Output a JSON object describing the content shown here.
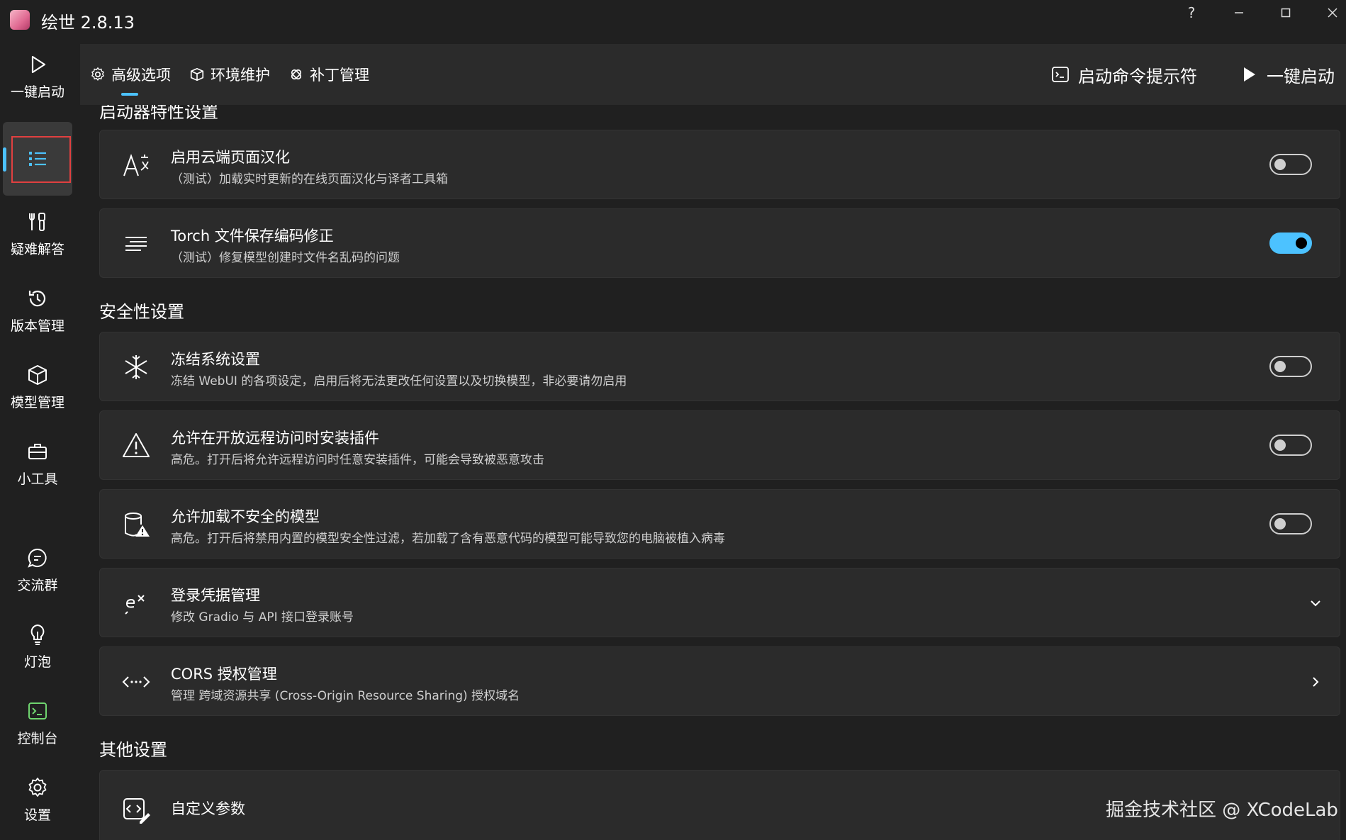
{
  "window": {
    "title": "绘世 2.8.13",
    "help": "?",
    "minimize": "–",
    "maximize": "☐",
    "close": "✕"
  },
  "sidebar": {
    "items": [
      {
        "label": "一键启动",
        "icon": "play-icon"
      },
      {
        "label": "",
        "icon": "list-icon",
        "selected": true
      },
      {
        "label": "疑难解答",
        "icon": "tools-icon"
      },
      {
        "label": "版本管理",
        "icon": "history-icon"
      },
      {
        "label": "模型管理",
        "icon": "cube-icon"
      },
      {
        "label": "小工具",
        "icon": "toolbox-icon"
      },
      {
        "label": "交流群",
        "icon": "chat-icon"
      },
      {
        "label": "灯泡",
        "icon": "bulb-icon"
      },
      {
        "label": "控制台",
        "icon": "console-icon"
      },
      {
        "label": "设置",
        "icon": "gear-icon"
      }
    ]
  },
  "topnav": {
    "tabs": [
      {
        "label": "高级选项",
        "icon": "gear-icon",
        "active": true
      },
      {
        "label": "环境维护",
        "icon": "box-icon"
      },
      {
        "label": "补丁管理",
        "icon": "patch-icon"
      }
    ],
    "console_btn": "启动命令提示符",
    "launch_btn": "一键启动"
  },
  "sections": {
    "launcher": "启动器特性设置",
    "security": "安全性设置",
    "other": "其他设置"
  },
  "cards": {
    "cloud_l10n": {
      "title": "启用云端页面汉化",
      "desc": "（测试）加载实时更新的在线页面汉化与译者工具箱",
      "enabled": false
    },
    "torch_fix": {
      "title": "Torch 文件保存编码修正",
      "desc": "（测试）修复模型创建时文件名乱码的问题",
      "enabled": true
    },
    "freeze": {
      "title": "冻结系统设置",
      "desc": "冻结 WebUI 的各项设定，启用后将无法更改任何设置以及切换模型，非必要请勿启用",
      "enabled": false
    },
    "remote_ext": {
      "title": "允许在开放远程访问时安装插件",
      "desc": "高危。打开后将允许远程访问时任意安装插件，可能会导致被恶意攻击",
      "enabled": false
    },
    "unsafe_model": {
      "title": "允许加载不安全的模型",
      "desc": "高危。打开后将禁用内置的模型安全性过滤，若加载了含有恶意代码的模型可能导致您的电脑被植入病毒",
      "enabled": false
    },
    "credentials": {
      "title": "登录凭据管理",
      "desc": "修改 Gradio 与 API 接口登录账号"
    },
    "cors": {
      "title": "CORS 授权管理",
      "desc": "管理 跨域资源共享 (Cross-Origin Resource Sharing) 授权域名"
    },
    "custom_args": {
      "title": "自定义参数"
    }
  },
  "watermark": "掘金技术社区 @ XCodeLab",
  "colors": {
    "accent": "#4cc2ff",
    "background": "#202020",
    "card": "#2b2b2b",
    "highlight_box": "#e04040"
  }
}
